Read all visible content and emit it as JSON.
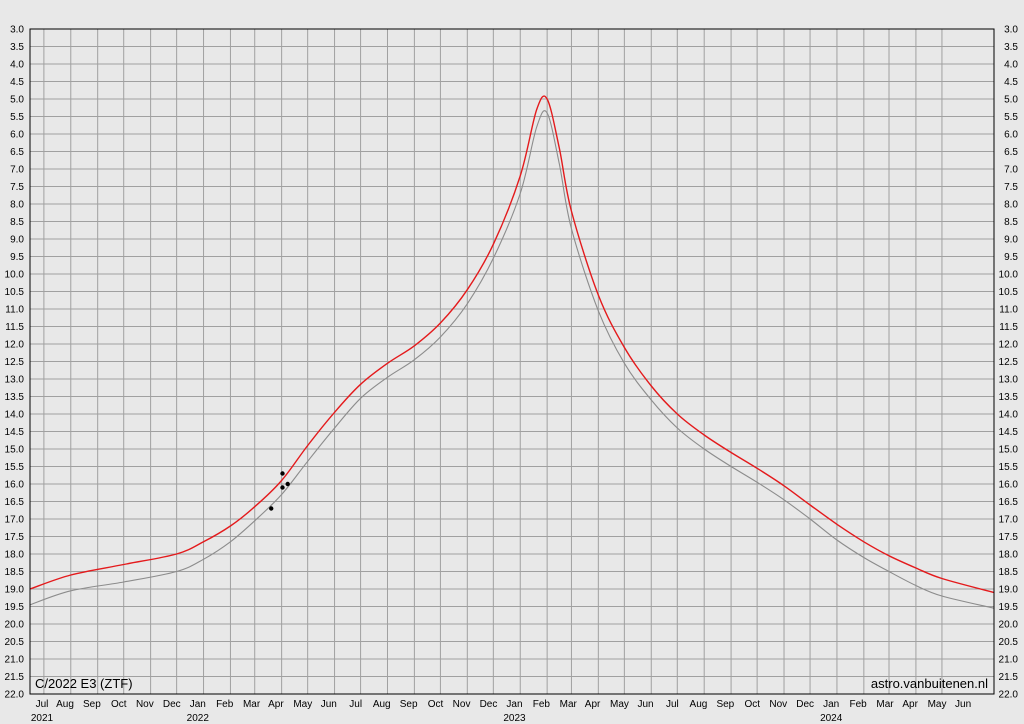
{
  "chart_data": {
    "type": "line",
    "object_label": "C/2022 E3 (ZTF)",
    "credit": "astro.vanbuitenen.nl",
    "y_axis": {
      "reversed": true,
      "ylim": [
        22.0,
        3.0
      ],
      "tick_step": 0.5,
      "tick_labels": [
        "3.0",
        "3.5",
        "4.0",
        "4.5",
        "5.0",
        "5.5",
        "6.0",
        "6.5",
        "7.0",
        "7.5",
        "8.0",
        "8.5",
        "9.0",
        "9.5",
        "10.0",
        "10.5",
        "11.0",
        "11.5",
        "12.0",
        "12.5",
        "13.0",
        "13.5",
        "14.0",
        "14.5",
        "15.0",
        "15.5",
        "16.0",
        "16.5",
        "17.0",
        "17.5",
        "18.0",
        "18.5",
        "19.0",
        "19.5",
        "20.0",
        "20.5",
        "21.0",
        "21.5",
        "22.0"
      ]
    },
    "x_axis": {
      "months": [
        "Jul",
        "Aug",
        "Sep",
        "Oct",
        "Nov",
        "Dec",
        "Jan",
        "Feb",
        "Mar",
        "Apr",
        "May",
        "Jun",
        "Jul",
        "Aug",
        "Sep",
        "Oct",
        "Nov",
        "Dec",
        "Jan",
        "Feb",
        "Mar",
        "Apr",
        "May",
        "Jun",
        "Jul",
        "Aug",
        "Sep",
        "Oct",
        "Nov",
        "Dec",
        "Jan",
        "Feb",
        "Mar",
        "Apr",
        "May",
        "Jun"
      ],
      "years": [
        {
          "label": "2021",
          "month_index": 0
        },
        {
          "label": "2022",
          "month_index": 6
        },
        {
          "label": "2023",
          "month_index": 18
        },
        {
          "label": "2024",
          "month_index": 30
        }
      ],
      "range": [
        "2021-06-15",
        "2024-06-30"
      ]
    },
    "grid": true,
    "series": [
      {
        "color": "#e41a1c",
        "points": [
          [
            "2021-06-15",
            19.0
          ],
          [
            "2021-08-01",
            18.6
          ],
          [
            "2021-10-01",
            18.3
          ],
          [
            "2021-12-01",
            18.0
          ],
          [
            "2022-01-01",
            17.65
          ],
          [
            "2022-02-01",
            17.2
          ],
          [
            "2022-03-01",
            16.65
          ],
          [
            "2022-04-01",
            15.9
          ],
          [
            "2022-05-01",
            14.9
          ],
          [
            "2022-06-01",
            13.95
          ],
          [
            "2022-07-01",
            13.15
          ],
          [
            "2022-08-01",
            12.55
          ],
          [
            "2022-09-01",
            12.05
          ],
          [
            "2022-10-01",
            11.4
          ],
          [
            "2022-11-01",
            10.45
          ],
          [
            "2022-12-01",
            9.15
          ],
          [
            "2023-01-01",
            7.2
          ],
          [
            "2023-01-20",
            5.3
          ],
          [
            "2023-02-01",
            5.0
          ],
          [
            "2023-02-15",
            6.4
          ],
          [
            "2023-03-01",
            8.2
          ],
          [
            "2023-04-01",
            10.6
          ],
          [
            "2023-05-01",
            12.1
          ],
          [
            "2023-06-01",
            13.2
          ],
          [
            "2023-07-01",
            14.0
          ],
          [
            "2023-08-01",
            14.6
          ],
          [
            "2023-09-01",
            15.1
          ],
          [
            "2023-10-01",
            15.55
          ],
          [
            "2023-11-01",
            16.05
          ],
          [
            "2023-12-01",
            16.6
          ],
          [
            "2024-01-01",
            17.15
          ],
          [
            "2024-02-01",
            17.65
          ],
          [
            "2024-03-01",
            18.05
          ],
          [
            "2024-04-01",
            18.4
          ],
          [
            "2024-05-01",
            18.7
          ],
          [
            "2024-06-30",
            19.1
          ]
        ]
      },
      {
        "color": "#8c8c8c",
        "points": [
          [
            "2021-06-15",
            19.45
          ],
          [
            "2021-08-01",
            19.05
          ],
          [
            "2021-10-01",
            18.8
          ],
          [
            "2021-12-01",
            18.5
          ],
          [
            "2022-01-01",
            18.15
          ],
          [
            "2022-02-01",
            17.65
          ],
          [
            "2022-03-01",
            17.05
          ],
          [
            "2022-04-01",
            16.3
          ],
          [
            "2022-05-01",
            15.35
          ],
          [
            "2022-06-01",
            14.4
          ],
          [
            "2022-07-01",
            13.55
          ],
          [
            "2022-08-01",
            12.95
          ],
          [
            "2022-09-01",
            12.45
          ],
          [
            "2022-10-01",
            11.8
          ],
          [
            "2022-11-01",
            10.85
          ],
          [
            "2022-12-01",
            9.55
          ],
          [
            "2023-01-01",
            7.7
          ],
          [
            "2023-01-20",
            5.8
          ],
          [
            "2023-02-01",
            5.4
          ],
          [
            "2023-02-15",
            6.85
          ],
          [
            "2023-03-01",
            8.7
          ],
          [
            "2023-04-01",
            11.05
          ],
          [
            "2023-05-01",
            12.55
          ],
          [
            "2023-06-01",
            13.6
          ],
          [
            "2023-07-01",
            14.4
          ],
          [
            "2023-08-01",
            15.0
          ],
          [
            "2023-09-01",
            15.5
          ],
          [
            "2023-10-01",
            15.95
          ],
          [
            "2023-11-01",
            16.45
          ],
          [
            "2023-12-01",
            17.0
          ],
          [
            "2024-01-01",
            17.6
          ],
          [
            "2024-02-01",
            18.1
          ],
          [
            "2024-03-01",
            18.5
          ],
          [
            "2024-04-01",
            18.9
          ],
          [
            "2024-05-01",
            19.2
          ],
          [
            "2024-06-30",
            19.55
          ]
        ]
      }
    ],
    "observations": [
      {
        "date": "2022-03-20",
        "mag": 16.7
      },
      {
        "date": "2022-04-02",
        "mag": 15.7
      },
      {
        "date": "2022-04-02",
        "mag": 16.1
      },
      {
        "date": "2022-04-08",
        "mag": 16.0
      }
    ]
  }
}
